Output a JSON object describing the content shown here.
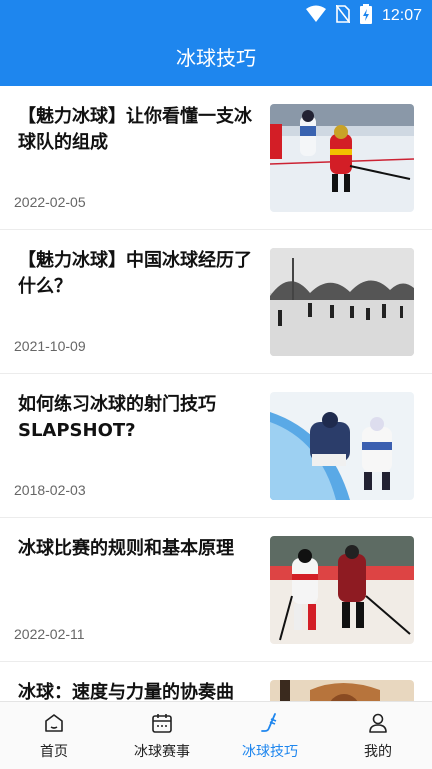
{
  "status_bar": {
    "time": "12:07"
  },
  "header": {
    "title": "冰球技巧"
  },
  "articles": [
    {
      "title": "【魅力冰球】让你看懂一支冰球队的组成",
      "date": "2022-02-05"
    },
    {
      "title": "【魅力冰球】中国冰球经历了什么？",
      "date": "2021-10-09"
    },
    {
      "title": "如何练习冰球的射门技巧SLAPSHOT?",
      "date": "2018-02-03"
    },
    {
      "title": "冰球比赛的规则和基本原理",
      "date": "2022-02-11"
    },
    {
      "title": "冰球：速度与力量的协奏曲",
      "date": ""
    }
  ],
  "tabs": [
    {
      "label": "首页",
      "icon": "home-icon"
    },
    {
      "label": "冰球赛事",
      "icon": "calendar-icon"
    },
    {
      "label": "冰球技巧",
      "icon": "hockey-stick-icon",
      "active": true
    },
    {
      "label": "我的",
      "icon": "user-icon"
    }
  ],
  "colors": {
    "primary": "#1e86ee",
    "inactive": "#222222"
  }
}
